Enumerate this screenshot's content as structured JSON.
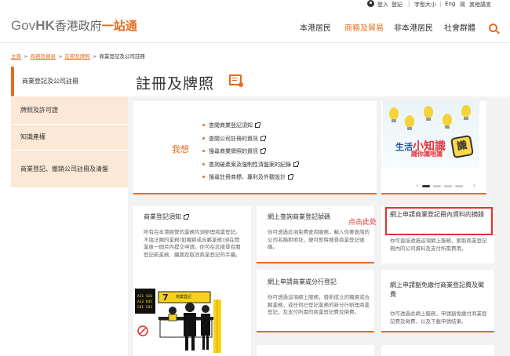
{
  "utility_bar": {
    "login": "登入",
    "register": "登記",
    "font_size": "字型大小",
    "lang_en": "Eng",
    "lang_sc": "简",
    "other_lang": "其他語言"
  },
  "header": {
    "logo_gov": "Gov",
    "logo_hk": "HK",
    "logo_cn": "香港政府",
    "logo_cn_accent": "一站通",
    "nav": [
      "本港居民",
      "商務及貿易",
      "非本港居民",
      "社會群體"
    ]
  },
  "breadcrumb": {
    "home": "主頁",
    "level1": "商務及貿易",
    "level2": "註冊及牌照",
    "current": "商業登記及公司註冊"
  },
  "sidebar": {
    "items": [
      {
        "label": "商業登記及公司註冊"
      },
      {
        "label": "牌照及許可證"
      },
      {
        "label": "知識產權"
      },
      {
        "label": "商業登記、撤銷公司註冊及清盤"
      }
    ]
  },
  "page": {
    "title": "註冊及牌照"
  },
  "iwant": {
    "label": "我想",
    "items": [
      "查閱商業登記須知",
      "查閱公司註冊的資訊",
      "搜尋商業牌照的資訊",
      "查詢破產案及強制性清盤案的紀錄",
      "搜尋註冊商標、專利及外觀設計"
    ]
  },
  "promo": {
    "line1a": "生活",
    "line1b": "小知識",
    "line2": "趣你識唔識",
    "seal": "識"
  },
  "cards": {
    "card1_title": "商業登記須知",
    "card1_body": "所有在本港經營的業務均須辦理商業登記。不論法團的業務(如獨資或合夥業務)須在開業後一個月內提交申請。你可在此搜尋有關登記新業務、續期及取消商業登記的手續。",
    "card2_title": "網上查詢商業登記號碼",
    "card2_body": "你可透過此項免費查詢服務，輸入你要查詢的公司名稱和地址，便可即時搜尋商業登記號碼。",
    "card3_title": "網上申請商業登記冊內資料的摘錄",
    "card3_body": "你可直接透過這項網上服務，索取商業登記冊內的公司資料及支付所需費用。",
    "card4_title": "網上申請商業或分行登記",
    "card4_body": "你可透過這項網上服務，替新成立的獨資或合夥業務，或任何已登記業務的新分行辦理商業登記，及支付所需的商業登記費及徵費。",
    "card5_title": "網上申請豁免繳付商業登記費及徵費",
    "card5_body": "你可透過此網上服務，申請豁免繳付商業登記費及徵費，以及下載申請結果。"
  },
  "annotation": {
    "click_here": "点击此处"
  },
  "illustration": {
    "counter_number": "7",
    "counter_sign": "商業登記",
    "board": [
      "A21 A26",
      "A13 B45",
      "C01 C03"
    ]
  },
  "colors": {
    "accent": "#e66b1e",
    "sidebar_bg": "#fbe8d6",
    "annotation": "#e53030"
  }
}
